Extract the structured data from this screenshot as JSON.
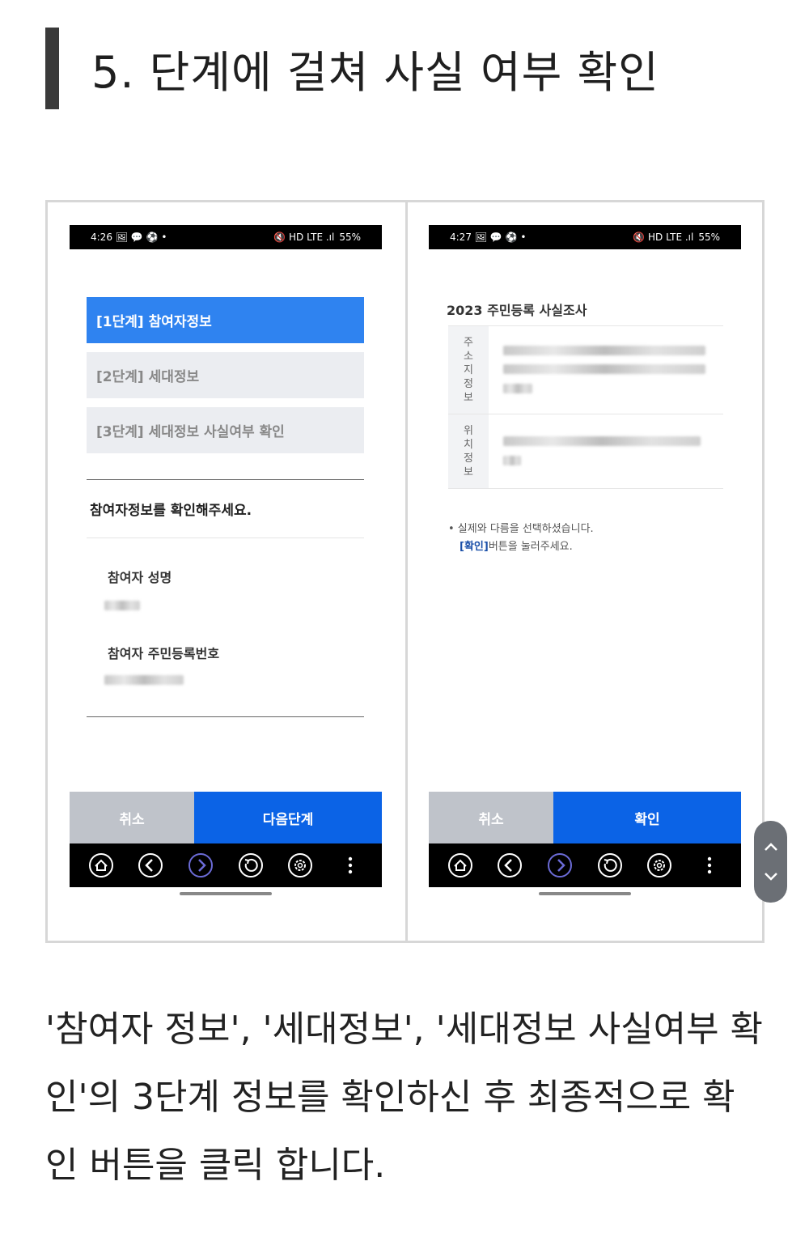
{
  "heading": {
    "title": "5. 단계에 걸쳐 사실 여부 확인"
  },
  "left_phone": {
    "status": {
      "time": "4:26",
      "icons_left": "🖼 💬 ⚽ •",
      "icons_right": "🔇 HD LTE .ıl",
      "battery": "55%"
    },
    "steps": [
      {
        "label": "[1단계] 참여자정보",
        "active": true
      },
      {
        "label": "[2단계] 세대정보",
        "active": false
      },
      {
        "label": "[3단계] 세대정보 사실여부 확인",
        "active": false
      }
    ],
    "confirm_message": "참여자정보를 확인해주세요.",
    "fields": [
      {
        "label": "참여자 성명"
      },
      {
        "label": "참여자 주민등록번호"
      }
    ],
    "buttons": {
      "cancel": "취소",
      "next": "다음단계"
    }
  },
  "right_phone": {
    "status": {
      "time": "4:27",
      "icons_left": "🖼 💬 ⚽ •",
      "icons_right": "🔇 HD LTE .ıl",
      "battery": "55%"
    },
    "survey_title": "2023 주민등록 사실조사",
    "rows": [
      {
        "header": "주\n소\n지\n정\n보"
      },
      {
        "header": "위\n치\n정\n보"
      }
    ],
    "note_line1": "• 실제와 다름을 선택하셨습니다.",
    "note_highlight": "[확인]",
    "note_line2_rest": "버튼을 눌러주세요.",
    "buttons": {
      "cancel": "취소",
      "confirm": "확인"
    }
  },
  "nav_icons": [
    "home-icon",
    "back-arrow-icon",
    "forward-arrow-icon",
    "refresh-icon",
    "gear-icon",
    "more-icon"
  ],
  "body_text": "'참여자 정보', '세대정보', '세대정보 사실여부 확인'의 3단계 정보를 확인하신 후 최종적으로 확인 버튼을 클릭 합니다.",
  "colors": {
    "active_step": "#2f83f0",
    "primary_button": "#0b63e6",
    "cancel_button": "#bfc3ca",
    "inactive_step": "#ebedf1",
    "nav_bar": "#000000"
  }
}
